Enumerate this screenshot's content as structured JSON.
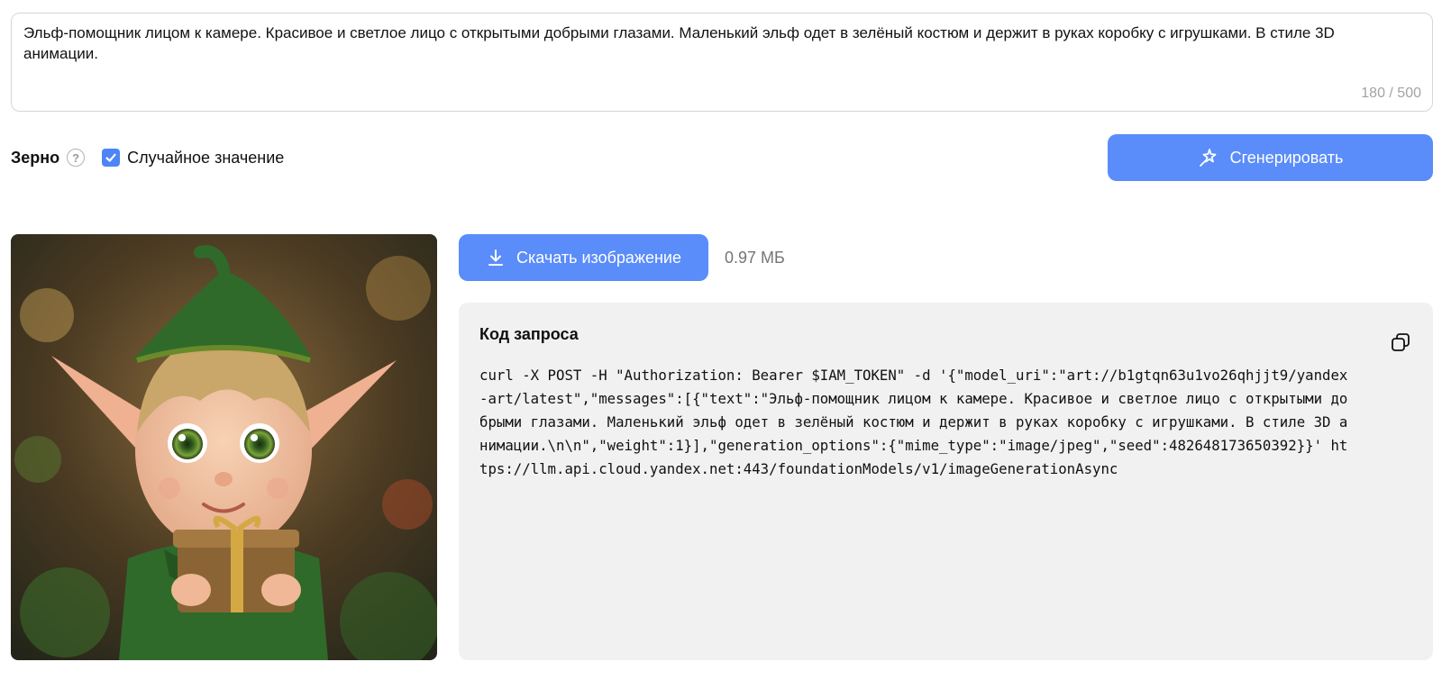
{
  "prompt": {
    "text": "Эльф-помощник лицом к камере. Красивое и светлое лицо с открытыми добрыми глазами. Маленький эльф одет в зелёный костюм и держит в руках коробку с игрушками. В стиле 3D анимации.",
    "counter": "180 / 500"
  },
  "seed": {
    "label": "Зерно",
    "help_icon": "question-circle-icon",
    "random_checked": true,
    "random_label": "Случайное значение"
  },
  "generate": {
    "label": "Сгенерировать",
    "icon": "magic-wand-sparkle-icon"
  },
  "result": {
    "image_alt": "elf helper holding gift box, 3D animation style",
    "download_label": "Скачать изображение",
    "download_icon": "download-icon",
    "file_size": "0.97 МБ"
  },
  "request_code": {
    "title": "Код запроса",
    "copy_icon": "copy-icon",
    "code": "curl -X POST -H \"Authorization: Bearer $IAM_TOKEN\" -d '{\"model_uri\":\"art://b1gtqn63u1vo26qhjjt9/yandex-art/latest\",\"messages\":[{\"text\":\"Эльф-помощник лицом к камере. Красивое и светлое лицо с открытыми добрыми глазами. Маленький эльф одет в зелёный костюм и держит в руках коробку с игрушками. В стиле 3D анимации.\\n\\n\",\"weight\":1}],\"generation_options\":{\"mime_type\":\"image/jpeg\",\"seed\":482648173650392}}' https://llm.api.cloud.yandex.net:443/foundationModels/v1/imageGenerationAsync"
  },
  "colors": {
    "accent": "#5a8cfa",
    "checkbox": "#4d84f7",
    "panel_bg": "#f1f1f2"
  }
}
